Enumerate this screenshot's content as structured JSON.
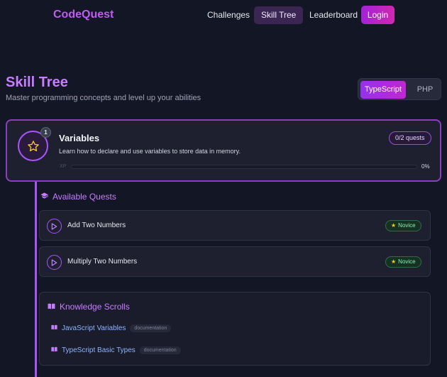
{
  "app": {
    "name": "CodeQuest"
  },
  "nav": {
    "challenges": "Challenges",
    "skill_tree": "Skill Tree",
    "leaderboard": "Leaderboard",
    "login": "Login"
  },
  "page": {
    "title": "Skill Tree",
    "subtitle": "Master programming concepts and level up your abilities"
  },
  "languages": {
    "selected": "TypeScript",
    "options": [
      "TypeScript",
      "PHP"
    ]
  },
  "skill": {
    "level": "1",
    "name": "Variables",
    "description": "Learn how to declare and use variables to store data in memory.",
    "quests": "0/2 quests",
    "xp_label": "XP",
    "xp_percent_text": "0%",
    "xp_progress": 0
  },
  "quests_section": {
    "title": "Available Quests",
    "items": [
      {
        "name": "Add Two Numbers",
        "difficulty": "Novice"
      },
      {
        "name": "Multiply Two Numbers",
        "difficulty": "Novice"
      }
    ]
  },
  "scrolls_section": {
    "title": "Knowledge Scrolls",
    "items": [
      {
        "name": "JavaScript Variables",
        "tag": "documentation"
      },
      {
        "name": "TypeScript Basic Types",
        "tag": "documentation"
      }
    ]
  },
  "colors": {
    "accent": "#a855f7",
    "brand": "#c05cf0",
    "novice": "#86efac"
  },
  "icons": {
    "skill": "star-icon",
    "quest": "play-icon",
    "section_quests": "graduation-cap-icon",
    "section_scrolls": "book-open-icon",
    "difficulty": "star-icon"
  }
}
